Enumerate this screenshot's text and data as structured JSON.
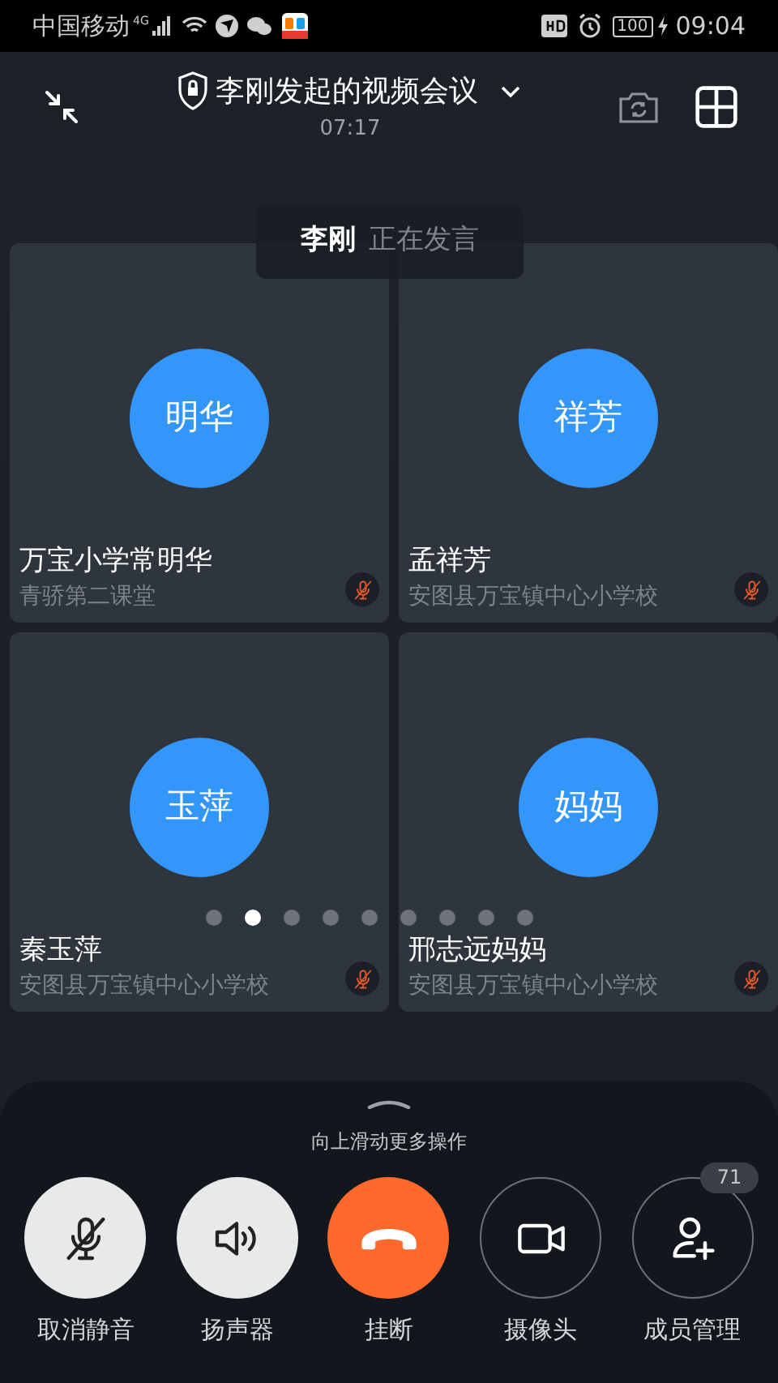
{
  "status_bar": {
    "carrier": "中国移动",
    "network": "4G",
    "battery": "100",
    "time": "09:04"
  },
  "header": {
    "title": "李刚发起的视频会议",
    "duration": "07:17"
  },
  "speaking_toast": {
    "name": "李刚",
    "status": "正在发言"
  },
  "participants": [
    {
      "avatar": "明华",
      "name": "万宝小学常明华",
      "org": "青骄第二课堂",
      "muted": true
    },
    {
      "avatar": "祥芳",
      "name": "孟祥芳",
      "org": "安图县万宝镇中心小学校",
      "muted": true
    },
    {
      "avatar": "玉萍",
      "name": "秦玉萍",
      "org": "安图县万宝镇中心小学校",
      "muted": true
    },
    {
      "avatar": "妈妈",
      "name": "邢志远妈妈",
      "org": "安图县万宝镇中心小学校",
      "muted": true
    }
  ],
  "pages": [
    {
      "selected": false
    },
    {
      "selected": true
    },
    {
      "selected": false
    },
    {
      "selected": false
    },
    {
      "selected": false
    },
    {
      "selected": false
    },
    {
      "selected": false
    },
    {
      "selected": false
    },
    {
      "selected": false
    }
  ],
  "controls": {
    "hint": "向上滑动更多操作",
    "buttons": [
      {
        "kind": "light",
        "label": "取消静音"
      },
      {
        "kind": "light",
        "label": "扬声器"
      },
      {
        "kind": "danger",
        "label": "挂断"
      },
      {
        "kind": "outline",
        "label": "摄像头"
      },
      {
        "kind": "outline",
        "label": "成员管理",
        "badge": "71"
      }
    ]
  }
}
